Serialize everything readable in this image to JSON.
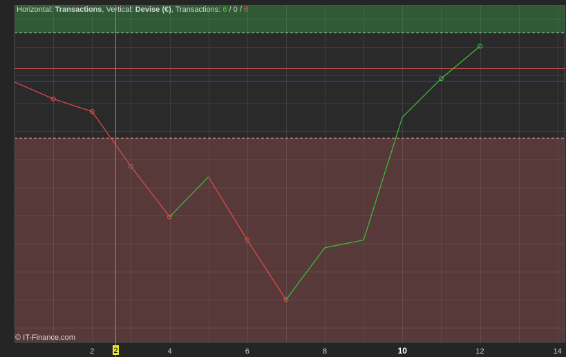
{
  "header": {
    "horizontal_label": "Horizontal: ",
    "horizontal_value": "Transactions",
    "vertical_label": ", Vertical: ",
    "vertical_value": "Devise (€)",
    "transactions_label": ", Transactions: ",
    "count_win": "6",
    "sep1": " / ",
    "count_neutral": "0",
    "sep2": " / ",
    "count_loss": "6"
  },
  "copyright": "© IT-Finance.com",
  "colors": {
    "background": "#252525",
    "plot_background": "#2a2a2a",
    "profit_zone": "#2f5a35",
    "loss_zone": "#563938",
    "up_segment": "#3ac43a",
    "down_segment": "#e84a4a",
    "reference_red": "#e85555",
    "reference_blue": "#3040e0",
    "grid": "#444444",
    "cursor": "#ff5555",
    "cursor_label_bg": "#e8e82a"
  },
  "chart_data": {
    "type": "line",
    "title": "",
    "xlabel": "Transactions",
    "ylabel": "Devise (€)",
    "xlim": [
      0,
      14.2
    ],
    "ylim": [
      -360,
      120
    ],
    "x_ticks": [
      "2",
      "4",
      "6",
      "8",
      "10",
      "12",
      "14"
    ],
    "highlighted_x_tick": "10",
    "cursor_x": 2.6,
    "cursor_label": "2",
    "profit_zone_start": 80,
    "loss_zone_start": -70,
    "reference_lines": [
      {
        "value": 30,
        "color": "red"
      },
      {
        "value": 12,
        "color": "blue"
      }
    ],
    "points": [
      {
        "x": 0,
        "y": 10
      },
      {
        "x": 1,
        "y": -14
      },
      {
        "x": 2,
        "y": -32
      },
      {
        "x": 3,
        "y": -110
      },
      {
        "x": 4,
        "y": -182
      },
      {
        "x": 5,
        "y": -125
      },
      {
        "x": 6,
        "y": -215
      },
      {
        "x": 7,
        "y": -300
      },
      {
        "x": 8,
        "y": -226
      },
      {
        "x": 9,
        "y": -215
      },
      {
        "x": 10,
        "y": -40
      },
      {
        "x": 11,
        "y": 15
      },
      {
        "x": 12,
        "y": 61
      }
    ],
    "marked_points": [
      1,
      2,
      3,
      4,
      6,
      7,
      11,
      12
    ]
  }
}
